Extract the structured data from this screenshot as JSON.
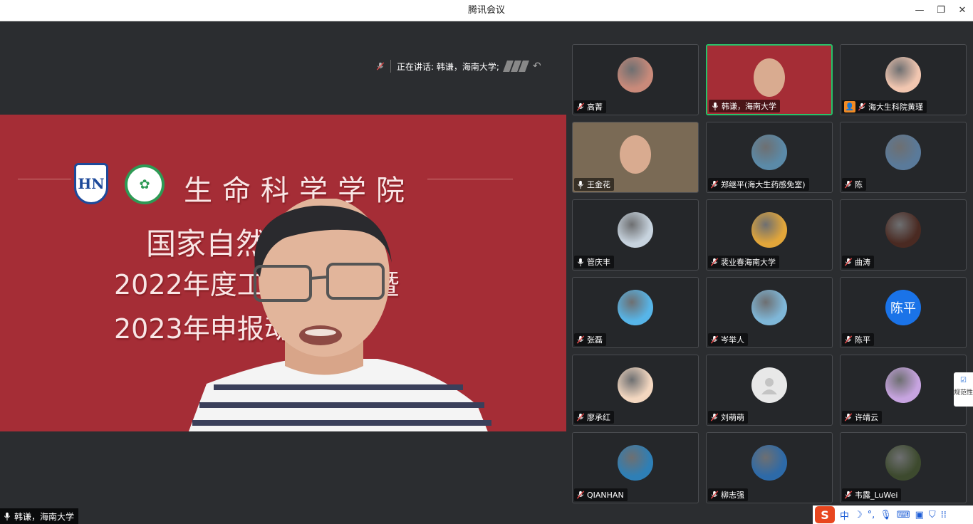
{
  "window": {
    "title": "腾讯会议",
    "minimize": "—",
    "restore": "❐",
    "close": "✕"
  },
  "main": {
    "speaking_label": "正在讲话: 韩谦，海南大学;",
    "speaker_name": "韩谦，海南大学",
    "slide": {
      "school": "生命科学学院",
      "line1": "国家自然科学基金",
      "line2": "2022年度工作总结会暨",
      "line3": "2023年申报动员会",
      "logo_left": "HN"
    }
  },
  "gallery": {
    "tiles": [
      {
        "name": "高菁",
        "avatar": "photo",
        "color": "#c98a7a",
        "mic": "muted"
      },
      {
        "name": "韩谦，海南大学",
        "avatar": "video",
        "color": "#a52d36",
        "mic": "on",
        "active": true
      },
      {
        "name": "海大生科院黄瑾",
        "avatar": "cartoon",
        "color": "#f1c6b0",
        "mic": "muted",
        "badge": true
      },
      {
        "name": "王金花",
        "avatar": "video",
        "color": "#7a6a55",
        "mic": "on"
      },
      {
        "name": "郑继平(海大生药感免室)",
        "avatar": "photo",
        "color": "#5b8aa8",
        "mic": "muted"
      },
      {
        "name": "陈",
        "avatar": "photo",
        "color": "#5a7a9a",
        "mic": "muted"
      },
      {
        "name": "管庆丰",
        "avatar": "photo",
        "color": "#c7d3de",
        "mic": "on"
      },
      {
        "name": "裴业春海南大学",
        "avatar": "photo",
        "color": "#e2a63a",
        "mic": "muted"
      },
      {
        "name": "曲涛",
        "avatar": "photo",
        "color": "#4a2a22",
        "mic": "muted"
      },
      {
        "name": "张磊",
        "avatar": "cartoon",
        "color": "#57b5e8",
        "mic": "muted"
      },
      {
        "name": "岑举人",
        "avatar": "photo",
        "color": "#7fb7d8",
        "mic": "muted"
      },
      {
        "name": "陈平",
        "avatar": "text",
        "initials": "陈平",
        "color": "#1a73e8",
        "mic": "muted"
      },
      {
        "name": "廖承红",
        "avatar": "cartoon",
        "color": "#f3d7c0",
        "mic": "muted"
      },
      {
        "name": "刘萌萌",
        "avatar": "default",
        "color": "#e8e8e8",
        "mic": "muted"
      },
      {
        "name": "许靖云",
        "avatar": "cartoon",
        "color": "#c7a4e0",
        "mic": "muted"
      },
      {
        "name": "QIANHAN",
        "avatar": "photo",
        "color": "#2e7fb6",
        "mic": "muted"
      },
      {
        "name": "柳志强",
        "avatar": "photo",
        "color": "#2d6aa8",
        "mic": "muted"
      },
      {
        "name": "韦露_LuWei",
        "avatar": "photo",
        "color": "#3d4a2e",
        "mic": "muted"
      }
    ]
  },
  "side_widget": {
    "label": "规范性"
  },
  "ime": {
    "logo": "S",
    "items": [
      "中",
      "☽",
      "°,",
      "🎤",
      "⌨",
      "👤",
      "👕",
      "⋮⋮"
    ]
  },
  "colors": {
    "active_border": "#27c26a",
    "slide_bg": "#a52d36",
    "muted_mic": "#e04848"
  }
}
